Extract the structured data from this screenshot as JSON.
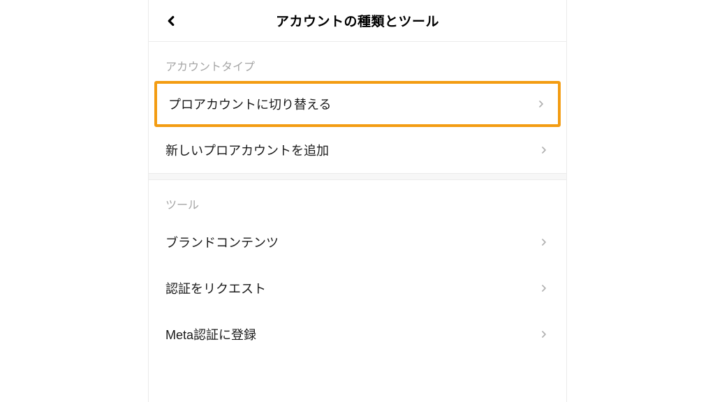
{
  "header": {
    "title": "アカウントの種類とツール"
  },
  "sections": {
    "account_type": {
      "header": "アカウントタイプ",
      "items": [
        {
          "label": "プロアカウントに切り替える"
        },
        {
          "label": "新しいプロアカウントを追加"
        }
      ]
    },
    "tools": {
      "header": "ツール",
      "items": [
        {
          "label": "ブランドコンテンツ"
        },
        {
          "label": "認証をリクエスト"
        },
        {
          "label": "Meta認証に登録"
        }
      ]
    }
  },
  "highlight_color": "#f39c12"
}
